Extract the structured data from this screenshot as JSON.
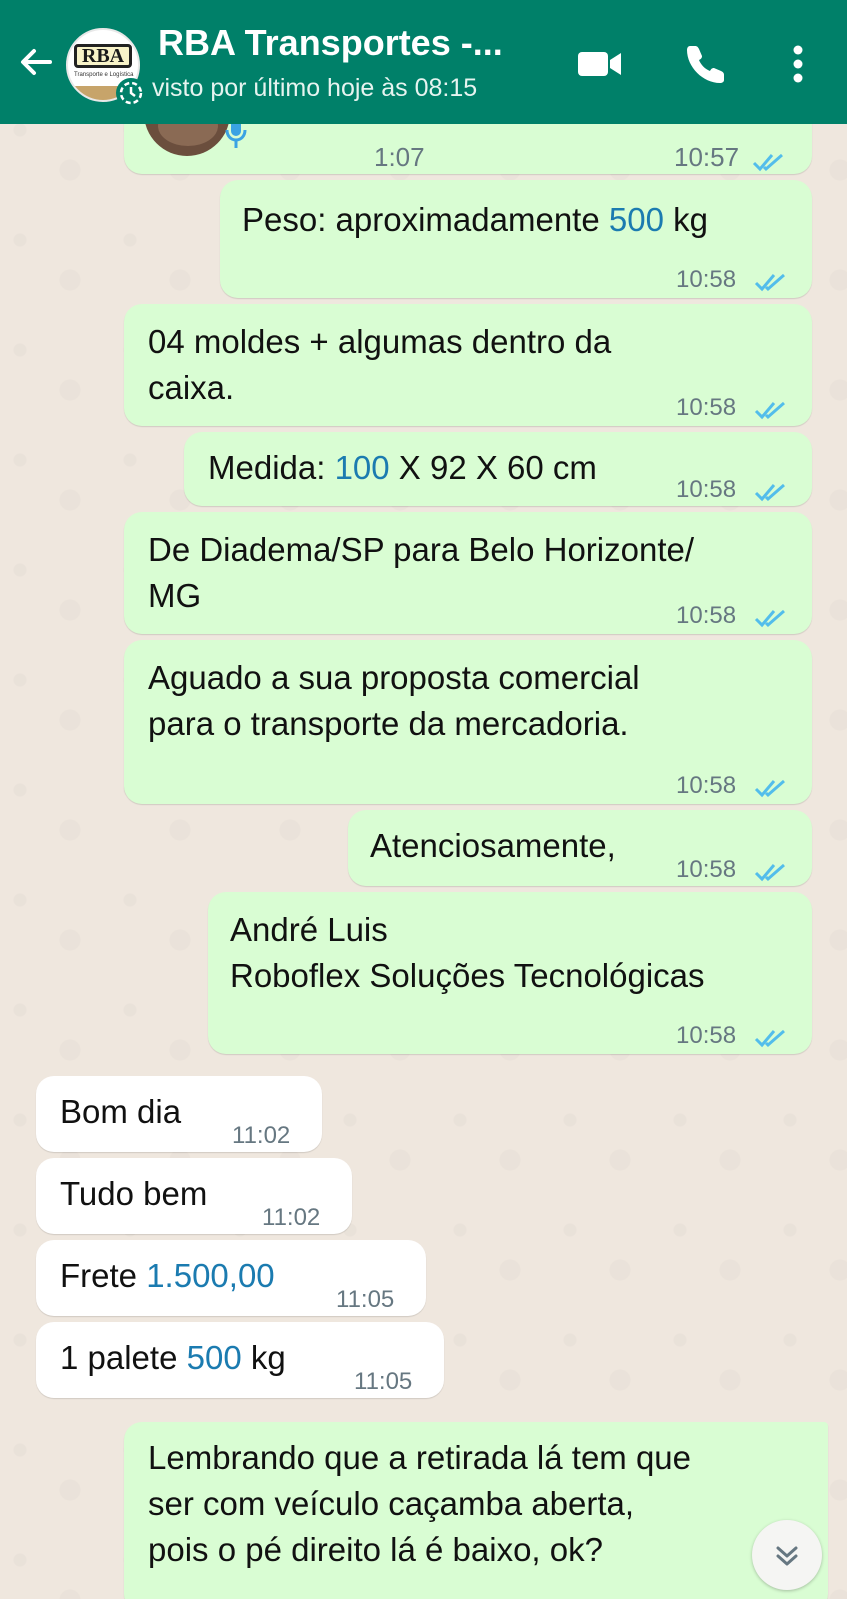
{
  "header": {
    "title": "RBA Transportes -...",
    "subtitle": "visto por último hoje às 08:15",
    "avatar_text": "RBA",
    "avatar_subtext": "Transporte e Logística"
  },
  "audio_message": {
    "duration": "1:07",
    "time": "10:57"
  },
  "messages": [
    {
      "direction": "out",
      "parts": [
        {
          "t": "Peso: aproximadamente "
        },
        {
          "t": "500",
          "hl": true
        },
        {
          "t": " kg"
        }
      ],
      "time": "10:58"
    },
    {
      "direction": "out",
      "lines": [
        "04 moldes + algumas dentro da",
        "caixa."
      ],
      "time": "10:58"
    },
    {
      "direction": "out",
      "parts": [
        {
          "t": "Medida: "
        },
        {
          "t": "100",
          "hl": true
        },
        {
          "t": " X 92 X 60 cm"
        }
      ],
      "time": "10:58"
    },
    {
      "direction": "out",
      "lines": [
        "De Diadema/SP para Belo Horizonte/",
        "MG"
      ],
      "time": "10:58"
    },
    {
      "direction": "out",
      "lines": [
        "Aguado a sua proposta comercial",
        "para o transporte da mercadoria."
      ],
      "time": "10:58"
    },
    {
      "direction": "out",
      "lines": [
        "Atenciosamente,"
      ],
      "time": "10:58"
    },
    {
      "direction": "out",
      "lines": [
        "André Luis",
        "Roboflex Soluções Tecnológicas"
      ],
      "time": "10:58"
    },
    {
      "direction": "in",
      "lines": [
        "Bom dia"
      ],
      "time": "11:02"
    },
    {
      "direction": "in",
      "lines": [
        "Tudo bem"
      ],
      "time": "11:02"
    },
    {
      "direction": "in",
      "parts": [
        {
          "t": "Frete "
        },
        {
          "t": "1.500,00",
          "hl": true
        }
      ],
      "time": "11:05"
    },
    {
      "direction": "in",
      "parts": [
        {
          "t": "1 palete "
        },
        {
          "t": "500",
          "hl": true
        },
        {
          "t": " kg"
        }
      ],
      "time": "11:05"
    },
    {
      "direction": "out",
      "lines": [
        "Lembrando que a retirada lá tem que",
        "ser com veículo caçamba aberta,",
        "pois o pé direito lá é baixo, ok?"
      ],
      "time": ""
    }
  ],
  "colors": {
    "header": "#008069",
    "outgoing": "#d9fdd3",
    "incoming": "#ffffff",
    "read_ticks": "#53bdeb",
    "link": "#1b7bb0"
  }
}
